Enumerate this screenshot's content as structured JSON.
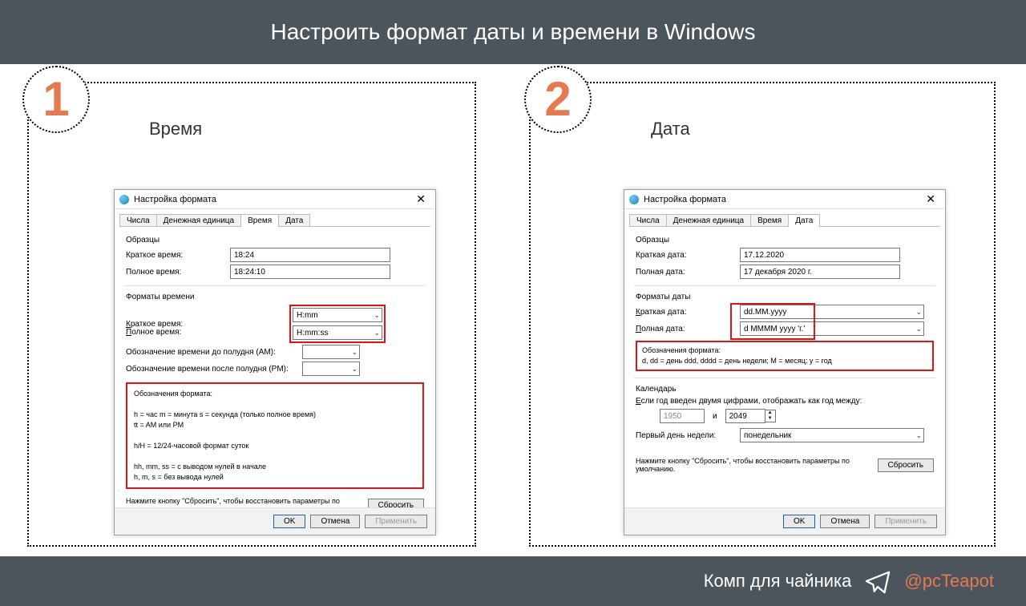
{
  "header": {
    "title": "Настроить формат даты и времени в Windows"
  },
  "footer": {
    "text": "Комп для чайника",
    "handle": "@pcTeapot"
  },
  "panels": {
    "left": {
      "badge": "1",
      "title": "Время"
    },
    "right": {
      "badge": "2",
      "title": "Дата"
    }
  },
  "dialog": {
    "title": "Настройка формата",
    "tabs": {
      "numbers": "Числа",
      "currency": "Денежная единица",
      "time": "Время",
      "date": "Дата"
    },
    "samples_label": "Образцы",
    "reset_hint": "Нажмите кнопку \"Сбросить\", чтобы восстановить параметры по умолчанию.",
    "reset_btn": "Сбросить",
    "ok": "OK",
    "cancel": "Отмена",
    "apply": "Применить"
  },
  "time": {
    "short_label": "Краткое время:",
    "long_label": "Полное время:",
    "short_sample": "18:24",
    "long_sample": "18:24:10",
    "formats_label": "Форматы времени",
    "short_fmt": "H:mm",
    "long_fmt": "H:mm:ss",
    "am_label": "Обозначение времени до полудня (AM):",
    "pm_label": "Обозначение времени после полудня (PM):",
    "legend_title": "Обозначения формата:",
    "legend_l1": "h = час   m = минута   s = секунда (только полное время)",
    "legend_l2": "tt = AM или PM",
    "legend_l3": "h/H = 12/24-часовой формат суток",
    "legend_l4": "hh, mm, ss = с выводом нулей в начале",
    "legend_l5": "h, m, s = без вывода нулей"
  },
  "date": {
    "short_label": "Краткая дата:",
    "long_label": "Полная дата:",
    "short_sample": "17.12.2020",
    "long_sample": "17 декабря 2020 г.",
    "formats_label": "Форматы даты",
    "short_fmt": "dd.MM.yyyy",
    "long_fmt": "d MMMM yyyy 'г.'",
    "legend_title": "Обозначения формата:",
    "legend_body": "d, dd = день  ddd, dddd = день недели; M = месяц; y = год",
    "calendar_label": "Календарь",
    "two_digit_hint": "Если год введен двумя цифрами, отображать как год между:",
    "year_from": "1950",
    "and": "и",
    "year_to": "2049",
    "first_day_label": "Первый день недели:",
    "first_day_value": "понедельник"
  }
}
